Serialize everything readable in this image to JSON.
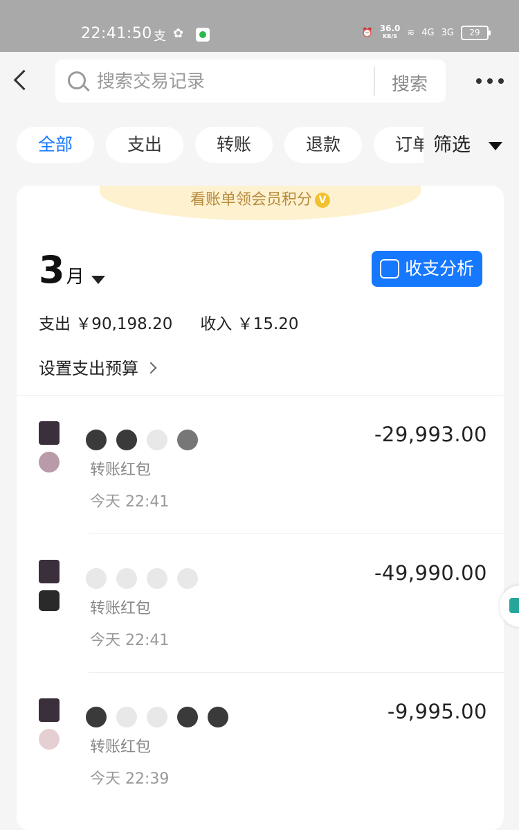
{
  "status_bar": {
    "time": "22:41:50",
    "icons": [
      "alipay-icon",
      "wechat-icon",
      "app-notification-icon",
      "alarm-icon",
      "wifi-icon",
      "signal-4g-icon",
      "signal-3g-icon"
    ],
    "app_icon_1": "支",
    "app_icon_2": "✿",
    "alarm": "⏰",
    "speed_value": "36.0",
    "speed_unit": "KB/S",
    "wifi": "≋",
    "sig1": "4G",
    "sig2": "3G",
    "battery": "29"
  },
  "top_bar": {
    "search_placeholder": "搜索交易记录",
    "search_button": "搜索"
  },
  "filters": {
    "chips": [
      "全部",
      "支出",
      "转账",
      "退款",
      "订单"
    ],
    "active_index": 0,
    "filter_label": "筛选"
  },
  "banner": {
    "text": "看账单领会员积分",
    "badge": "V"
  },
  "summary": {
    "month_number": "3",
    "month_unit": "月",
    "analysis_button": "收支分析",
    "expense": "支出 ￥90,198.20",
    "income": "收入 ￥15.20",
    "budget_link": "设置支出预算"
  },
  "records": [
    {
      "type": "转账红包",
      "time": "今天 22:41",
      "amount": "-29,993.00"
    },
    {
      "type": "转账红包",
      "time": "今天 22:41",
      "amount": "-49,990.00"
    },
    {
      "type": "转账红包",
      "time": "今天 22:39",
      "amount": "-9,995.00"
    }
  ],
  "colors": {
    "accent": "#1677ff",
    "banner_bg": "#fdf1cf",
    "banner_text": "#b78a3c",
    "status_bar": "#a9a9a9"
  }
}
